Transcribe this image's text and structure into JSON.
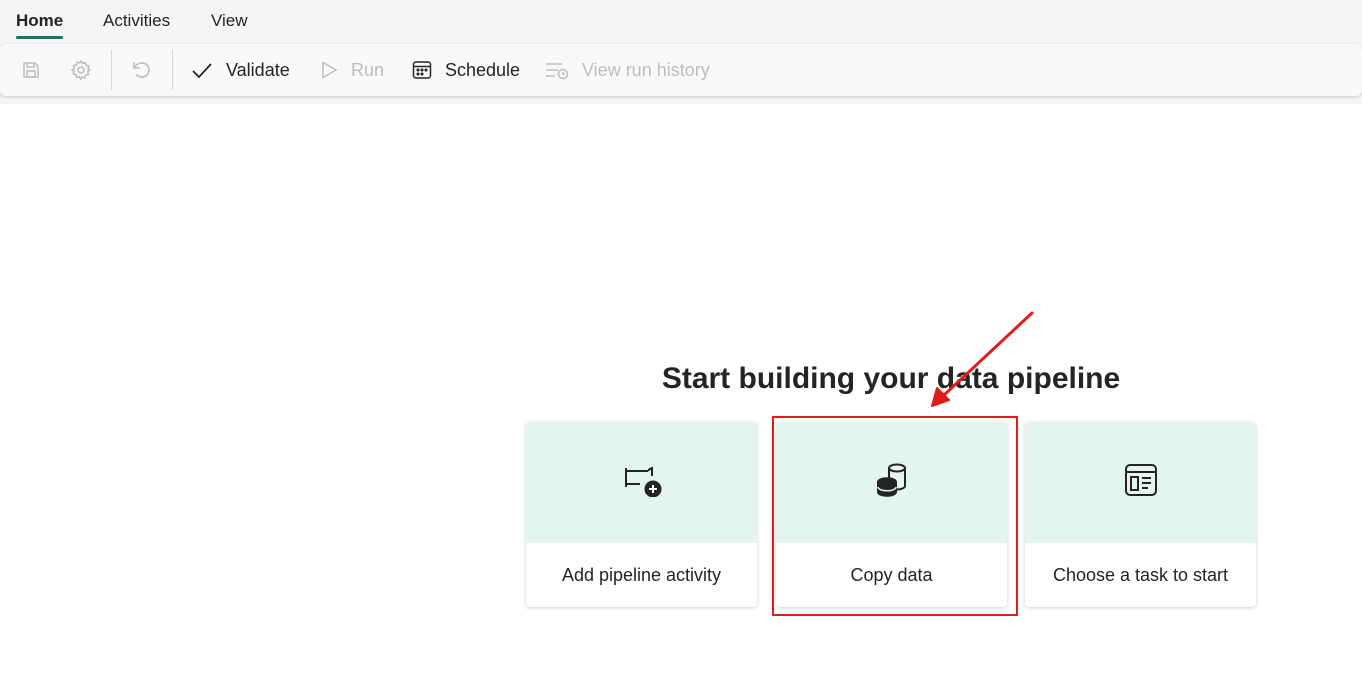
{
  "tabs": [
    {
      "label": "Home",
      "active": true
    },
    {
      "label": "Activities",
      "active": false
    },
    {
      "label": "View",
      "active": false
    }
  ],
  "toolbar": {
    "save_icon": "save-icon",
    "settings_icon": "gear-icon",
    "undo_icon": "undo-icon",
    "validate_label": "Validate",
    "run_label": "Run",
    "schedule_label": "Schedule",
    "view_run_history_label": "View run history"
  },
  "main": {
    "heading": "Start building your data pipeline",
    "cards": [
      {
        "label": "Add pipeline activity",
        "icon": "pipeline-activity-icon"
      },
      {
        "label": "Copy data",
        "icon": "database-copy-icon"
      },
      {
        "label": "Choose a task to start",
        "icon": "task-template-icon"
      }
    ]
  },
  "colors": {
    "accent": "#117865",
    "card_top": "#e4f5ed",
    "annotation": "#e21b1b"
  }
}
